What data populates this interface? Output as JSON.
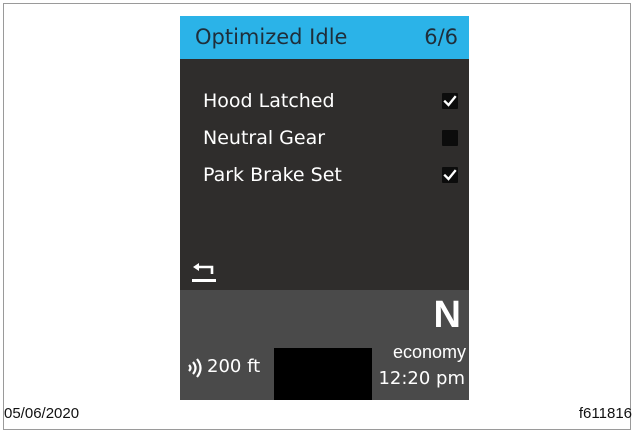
{
  "screen": {
    "title": "Optimized Idle",
    "page": "6/6",
    "accent_color": "#2bb3e8",
    "menu_items": [
      {
        "label": "Hood Latched",
        "checked": true
      },
      {
        "label": "Neutral Gear",
        "checked": false
      },
      {
        "label": "Park Brake Set",
        "checked": true
      }
    ],
    "back_icon": "back-arrow-icon"
  },
  "status": {
    "gear": "N",
    "radio_icon": "radio-wave-icon",
    "distance": "200 ft",
    "mode": "economy",
    "time": "12:20 pm"
  },
  "footer": {
    "date": "05/06/2020",
    "figure_code": "f611816"
  }
}
